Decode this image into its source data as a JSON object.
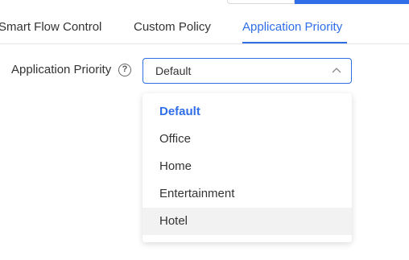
{
  "tabs": [
    {
      "label": "Smart Flow Control"
    },
    {
      "label": "Custom Policy"
    },
    {
      "label": "Application Priority"
    }
  ],
  "form": {
    "label": "Application Priority",
    "help_icon": "question-circle-icon",
    "selected_value": "Default"
  },
  "dropdown": {
    "options": [
      {
        "label": "Default"
      },
      {
        "label": "Office"
      },
      {
        "label": "Home"
      },
      {
        "label": "Entertainment"
      },
      {
        "label": "Hotel"
      }
    ]
  },
  "colors": {
    "primary": "#2f6ee6",
    "text": "#333333",
    "hover_bg": "#f2f2f2"
  }
}
